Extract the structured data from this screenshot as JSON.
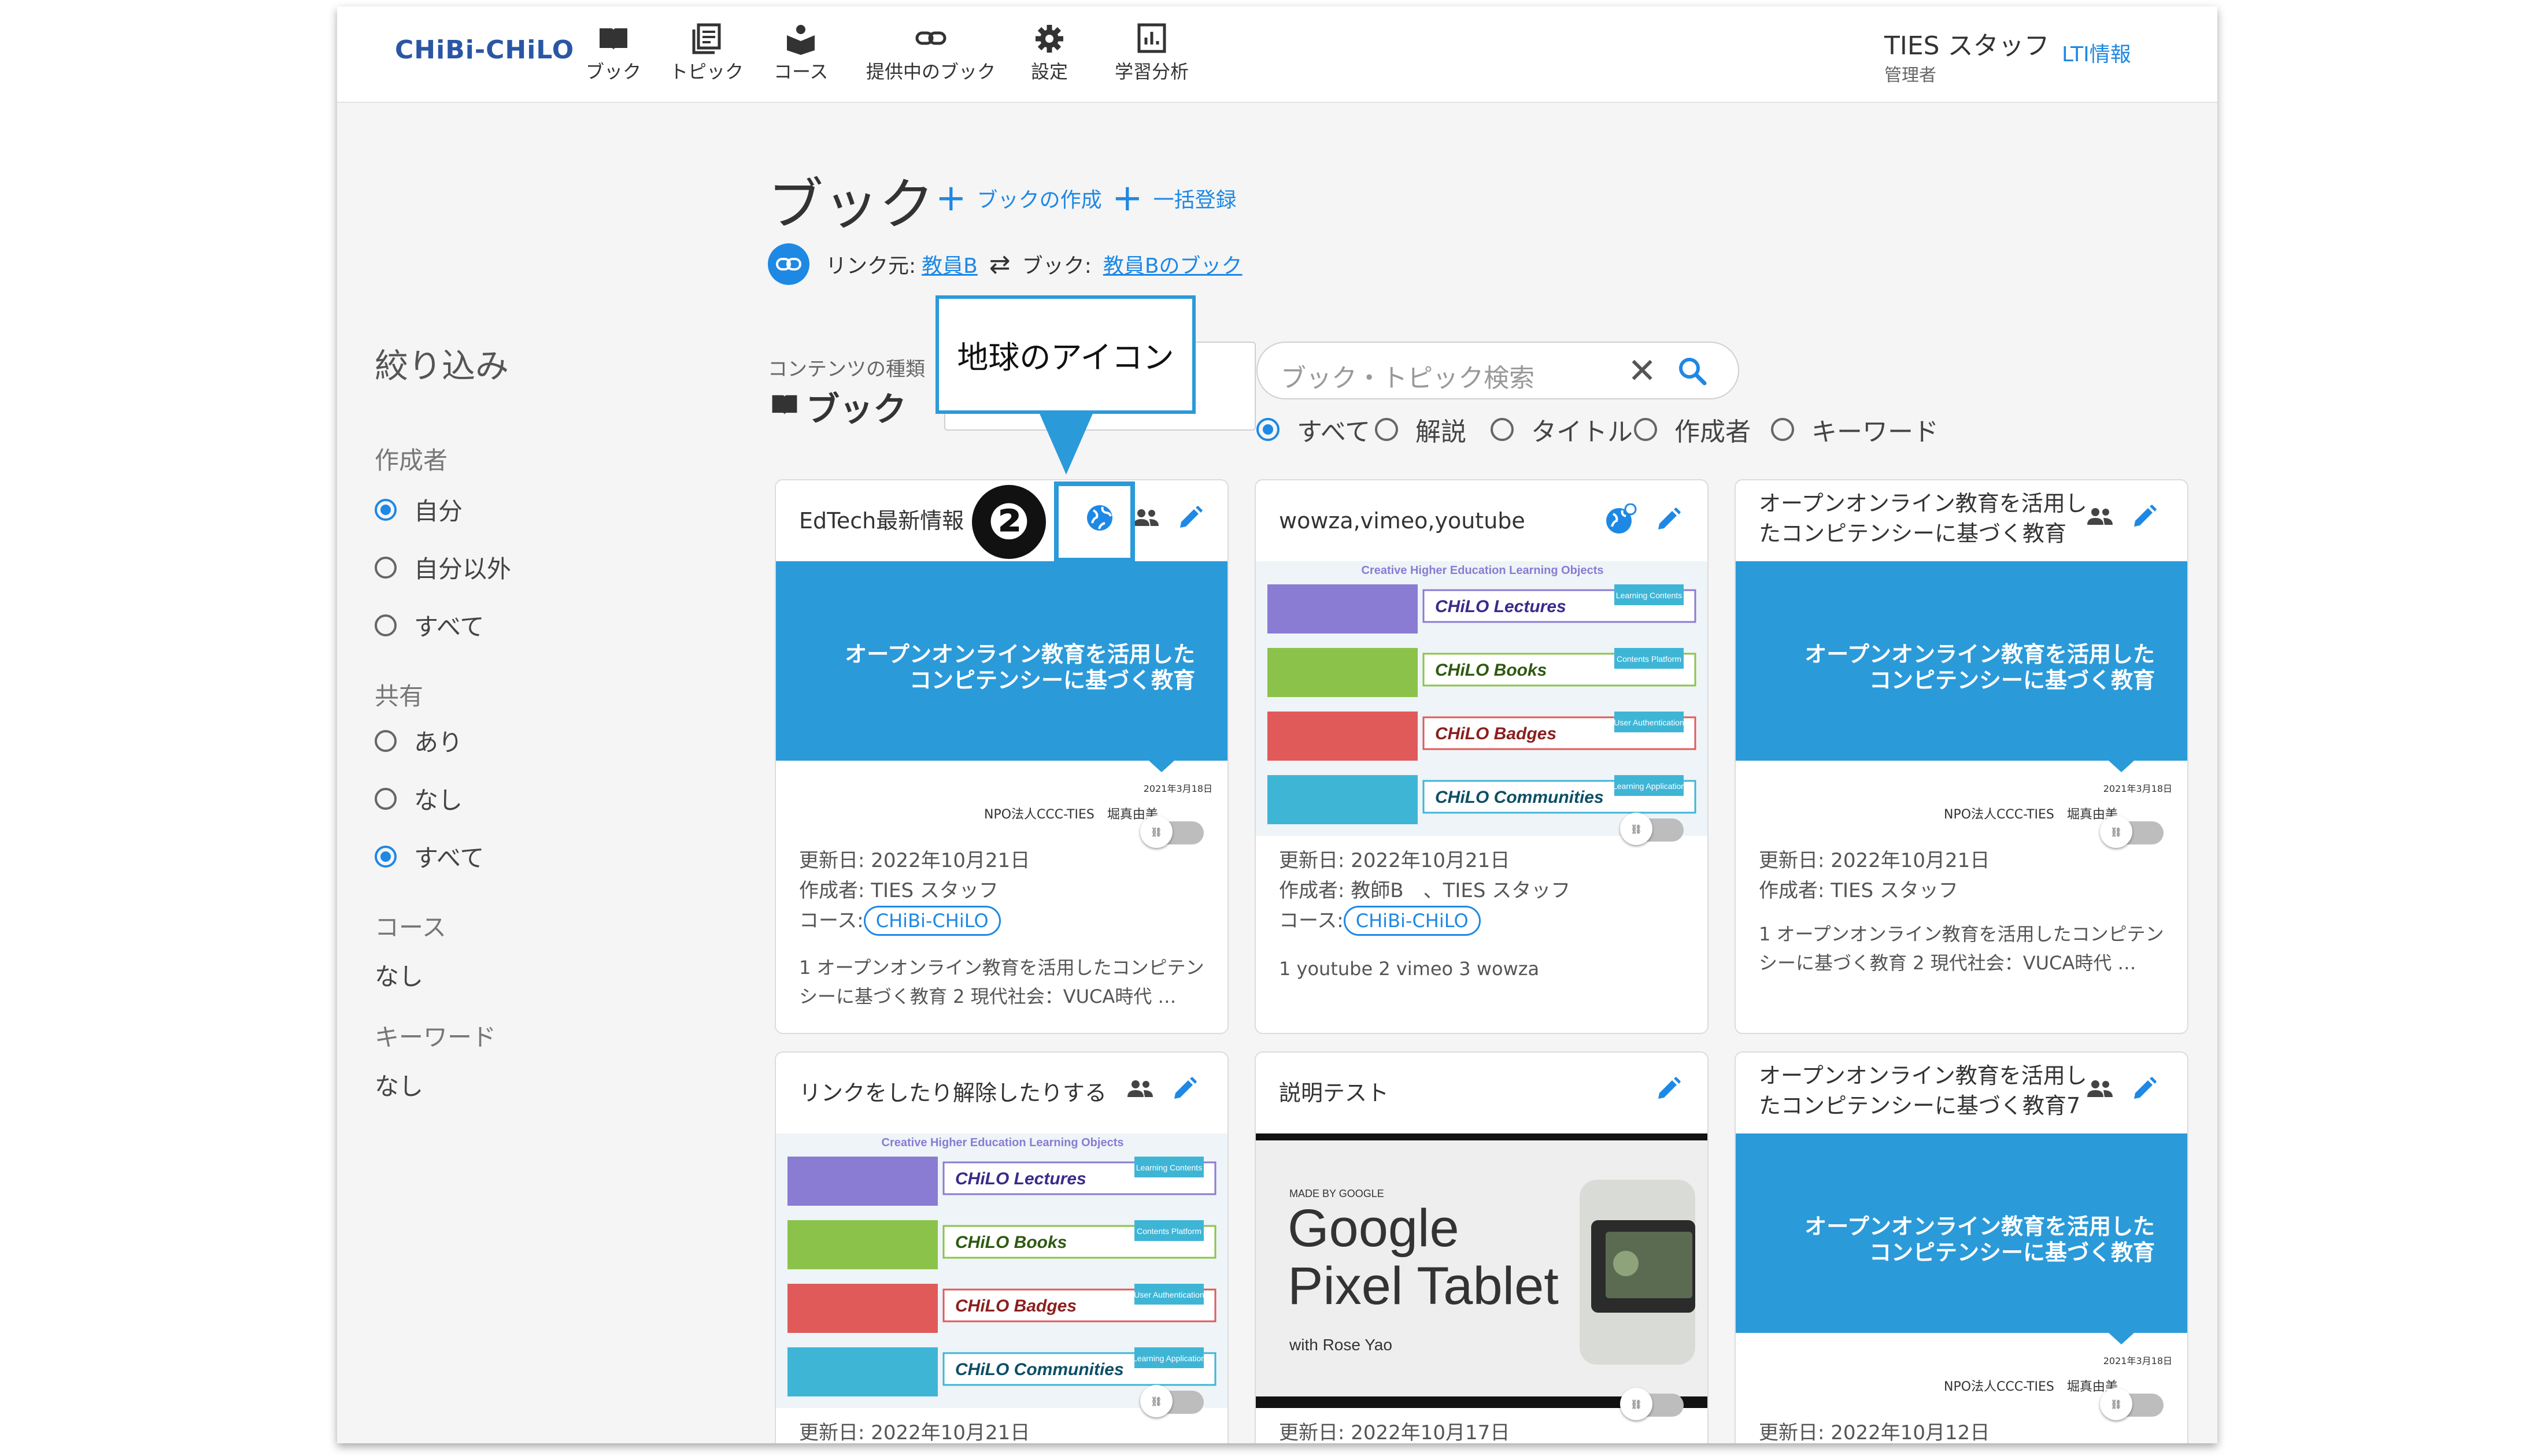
{
  "header": {
    "logo": "CHiBi-CHiLO",
    "nav": [
      {
        "label": "ブック",
        "icon": "book-icon"
      },
      {
        "label": "トピック",
        "icon": "topic-icon"
      },
      {
        "label": "コース",
        "icon": "course-icon"
      },
      {
        "label": "提供中のブック",
        "icon": "link-icon"
      },
      {
        "label": "設定",
        "icon": "gear-icon"
      },
      {
        "label": "学習分析",
        "icon": "analytics-icon"
      }
    ],
    "user_name": "TIES スタッフ",
    "user_role": "管理者",
    "lti_link": "LTI情報"
  },
  "filter": {
    "title": "絞り込み",
    "author_label": "作成者",
    "author_options": [
      "自分",
      "自分以外",
      "すべて"
    ],
    "author_selected": 0,
    "share_label": "共有",
    "share_options": [
      "あり",
      "なし",
      "すべて"
    ],
    "share_selected": 2,
    "course_label": "コース",
    "course_value": "なし",
    "keyword_label": "キーワード",
    "keyword_value": "なし"
  },
  "main": {
    "title": "ブック",
    "create_book": "ブックの作成",
    "bulk_register": "一括登録",
    "link_source_label": "リンク元:",
    "link_source_value": "教員B",
    "link_book_label": "ブック:",
    "link_book_value": "教員Bのブック",
    "content_type_label": "コンテンツの種類",
    "content_type_value": "ブック",
    "search_placeholder": "ブック・トピック検索",
    "search_options": [
      "すべて",
      "解説",
      "タイトル",
      "作成者",
      "キーワード"
    ],
    "search_selected": 0
  },
  "annotation": {
    "callout": "地球のアイコン",
    "badge": "❷"
  },
  "cover_text": {
    "line1": "オープンオンライン教育を活用した",
    "line2": "コンピテンシーに基づく教育",
    "org": "NPO法人CCC-TIES　堀真由美",
    "date": "2021年3月18日"
  },
  "cards": [
    {
      "title": "EdTech最新情報",
      "updated": "更新日: 2022年10月21日",
      "author": "作成者: TIES スタッフ",
      "course_label": "コース:",
      "course": "CHiBi-CHiLO",
      "desc": "1 オープンオンライン教育を活用したコンピテンシーに基づく教育 2 現代社会：VUCA時代 …"
    },
    {
      "title": "wowza,vimeo,youtube",
      "updated": "更新日: 2022年10月21日",
      "author": "作成者: 教師B　、TIES スタッフ",
      "course_label": "コース:",
      "course": "CHiBi-CHiLO",
      "desc": "1 youtube 2 vimeo 3 wowza"
    },
    {
      "title_l1": "オープンオンライン教育を活用し",
      "title_l2": "たコンピテンシーに基づく教育",
      "updated": "更新日: 2022年10月21日",
      "author": "作成者: TIES スタッフ",
      "desc": "1 オープンオンライン教育を活用したコンピテンシーに基づく教育 2 現代社会：VUCA時代 …"
    },
    {
      "title": "リンクをしたり解除したりする",
      "updated": "更新日: 2022年10月21日"
    },
    {
      "title": "説明テスト",
      "updated": "更新日: 2022年10月17日"
    },
    {
      "title_l1": "オープンオンライン教育を活用し",
      "title_l2": "たコンピテンシーに基づく教育7",
      "updated": "更新日: 2022年10月12日"
    }
  ],
  "chilo_slide": {
    "header": "Creative Higher Education Learning Objects",
    "rows": [
      {
        "title": "CHiLO Lectures",
        "tag": "Learning Contents",
        "color": "#8a7bd3"
      },
      {
        "title": "CHiLO Books",
        "tag": "Contents Platform",
        "color": "#8bc34a"
      },
      {
        "title": "CHiLO Badges",
        "tag": "User Authentication",
        "color": "#e05a5a"
      },
      {
        "title": "CHiLO Communities",
        "tag": "Learning Application",
        "color": "#3fb5d6"
      }
    ]
  },
  "pixel_slide": {
    "made_by": "MADE BY GOOGLE",
    "title_l1": "Google",
    "title_l2": "Pixel Tablet",
    "sub": "with Rose Yao"
  }
}
